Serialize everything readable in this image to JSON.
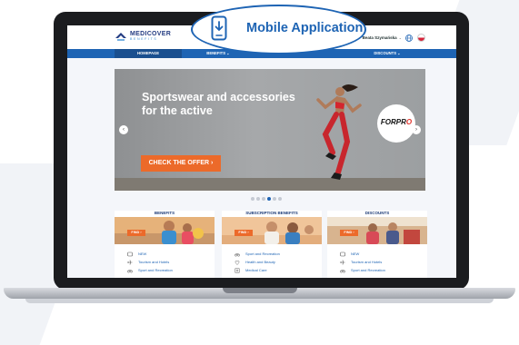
{
  "header": {
    "logo_title": "MEDICOVER",
    "logo_subtitle": "BENEFITS",
    "user_name": "Beata Szymańska"
  },
  "nav": {
    "items": [
      {
        "label": "HOMEPAGE"
      },
      {
        "label": "BENEFITS ⌄"
      },
      {
        "label": ""
      },
      {
        "label": "DISCOUNTS ⌄"
      }
    ]
  },
  "callout": {
    "label": "Mobile Application",
    "icon": "phone-download-icon"
  },
  "hero": {
    "title": "Sportswear and accessories for the active",
    "cta_label": "CHECK THE OFFER ›",
    "brand_badge_main": "FORPR",
    "brand_badge_accent": "O",
    "prev_symbol": "‹",
    "next_symbol": "›",
    "slides_total": 6,
    "slide_active_index": 3
  },
  "cards": [
    {
      "title": "BENEFITS",
      "find_label": "FIND ›",
      "items": [
        {
          "label": "NEW",
          "icon": "new-icon"
        },
        {
          "label": "Tourism and Hotels",
          "icon": "plane-icon"
        },
        {
          "label": "Sport and Recreation",
          "icon": "bike-icon"
        }
      ]
    },
    {
      "title": "SUBSCRIPTION BENEFITS",
      "find_label": "FIND ›",
      "items": [
        {
          "label": "Sport and Recreation",
          "icon": "bike-icon"
        },
        {
          "label": "Health and Beauty",
          "icon": "health-icon"
        },
        {
          "label": "Medical Care",
          "icon": "medical-icon"
        }
      ]
    },
    {
      "title": "DISCOUNTS",
      "find_label": "FIND ›",
      "items": [
        {
          "label": "NEW",
          "icon": "new-icon"
        },
        {
          "label": "Tourism and Hotels",
          "icon": "plane-icon"
        },
        {
          "label": "Sport and Recreation",
          "icon": "bike-icon"
        }
      ]
    }
  ],
  "colors": {
    "brand_blue": "#1e64b4",
    "accent_orange": "#ec6a2a",
    "laptop_body": "#1b1c1f"
  }
}
